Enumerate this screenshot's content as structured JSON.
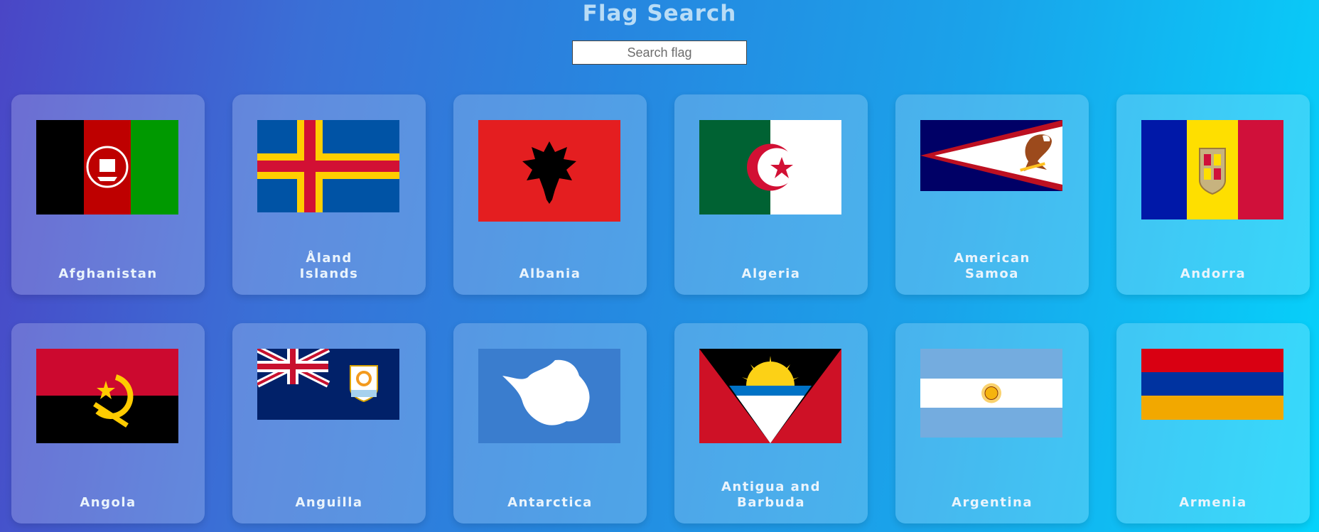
{
  "header": {
    "title": "Flag Search"
  },
  "search": {
    "placeholder": "Search flag",
    "value": ""
  },
  "countries": [
    {
      "name": "Afghanistan"
    },
    {
      "name": "Åland Islands"
    },
    {
      "name": "Albania"
    },
    {
      "name": "Algeria"
    },
    {
      "name": "American Samoa"
    },
    {
      "name": "Andorra"
    },
    {
      "name": "Angola"
    },
    {
      "name": "Anguilla"
    },
    {
      "name": "Antarctica"
    },
    {
      "name": "Antigua and Barbuda"
    },
    {
      "name": "Argentina"
    },
    {
      "name": "Armenia"
    }
  ],
  "colors": {
    "gradient_start": "#4a46c6",
    "gradient_end": "#05d3fb",
    "card_background": "rgba(255,255,255,0.20)",
    "title": "#b8dcf6"
  }
}
